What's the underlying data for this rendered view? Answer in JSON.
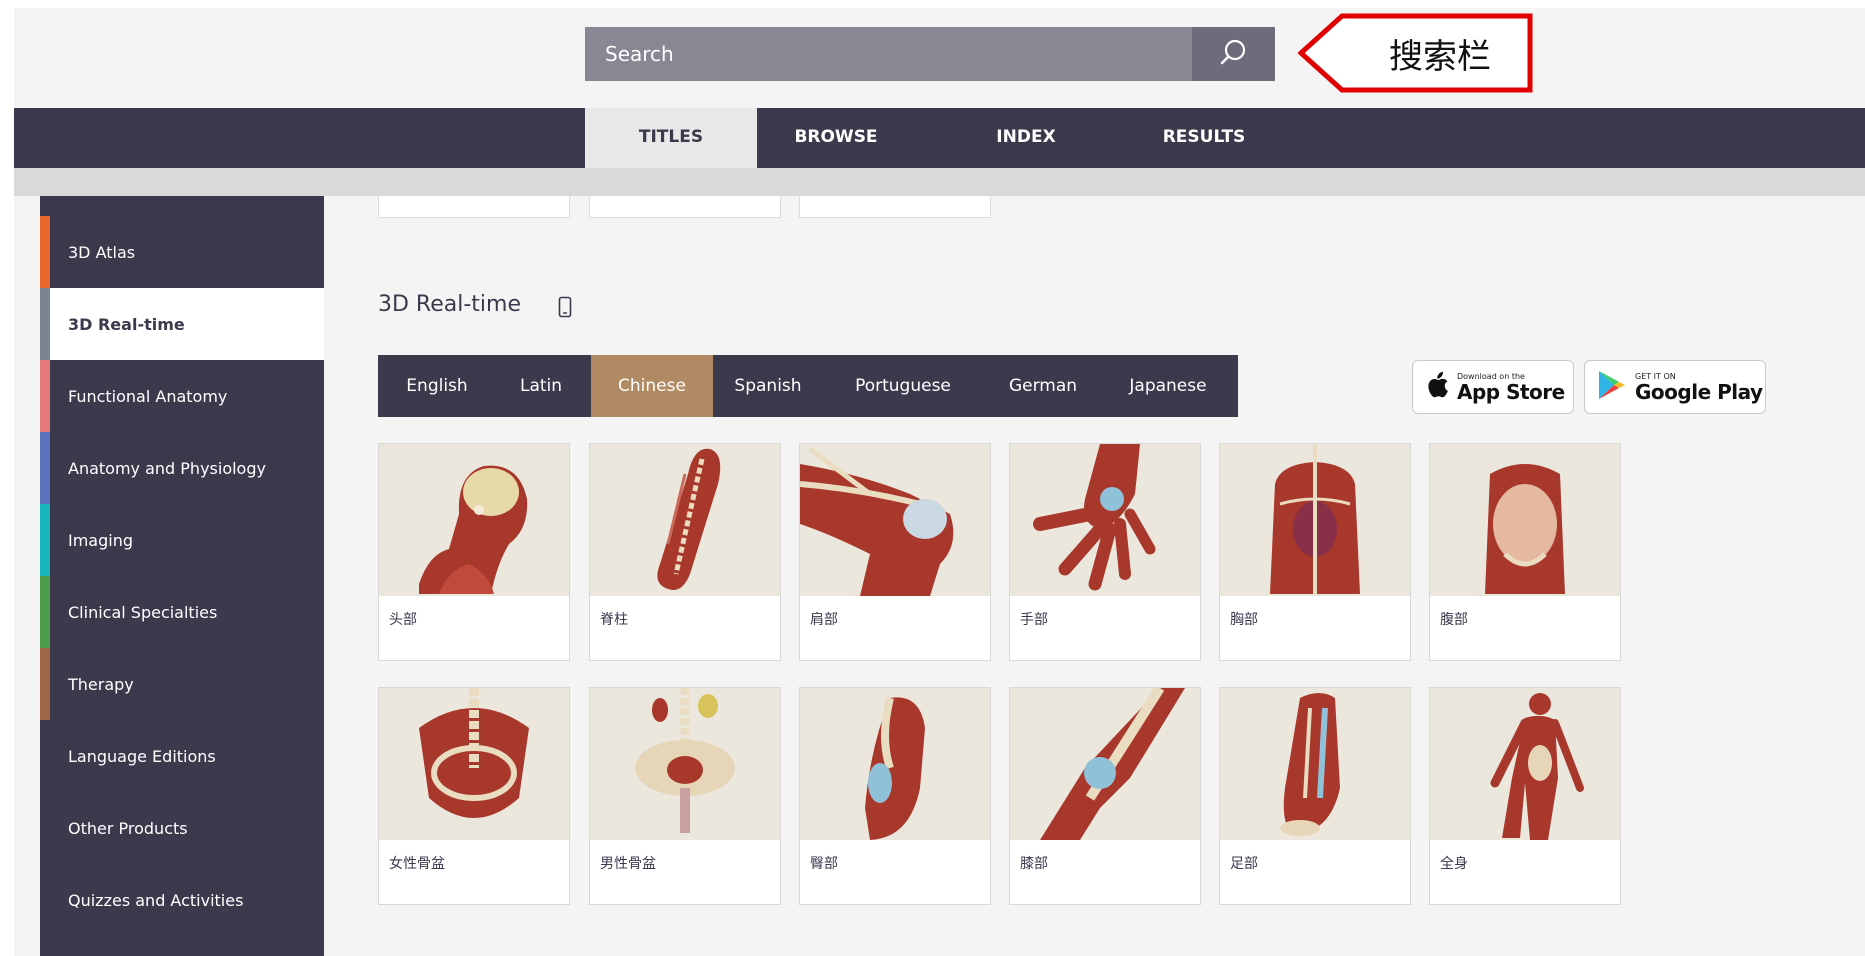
{
  "search": {
    "placeholder": "Search"
  },
  "annotation": {
    "label": "搜索栏",
    "color": "#e00000"
  },
  "top_nav": {
    "tabs": [
      {
        "label": "TITLES",
        "active": true
      },
      {
        "label": "BROWSE",
        "active": false
      },
      {
        "label": "INDEX",
        "active": false
      },
      {
        "label": "RESULTS",
        "active": false
      }
    ]
  },
  "sidebar": {
    "items": [
      {
        "label": "3D Atlas",
        "color": "#e9662c",
        "active": false
      },
      {
        "label": "3D Real-time",
        "color": "#7b8590",
        "active": true
      },
      {
        "label": "Functional Anatomy",
        "color": "#e57a7a",
        "active": false
      },
      {
        "label": "Anatomy and Physiology",
        "color": "#5e73c0",
        "active": false
      },
      {
        "label": "Imaging",
        "color": "#19b5bd",
        "active": false
      },
      {
        "label": "Clinical Specialties",
        "color": "#4c9e4a",
        "active": false
      },
      {
        "label": "Therapy",
        "color": "#9c6647",
        "active": false
      },
      {
        "label": "Language Editions",
        "color": "",
        "active": false
      },
      {
        "label": "Other Products",
        "color": "",
        "active": false
      },
      {
        "label": "Quizzes and Activities",
        "color": "",
        "active": false
      }
    ]
  },
  "section": {
    "title": "3D Real-time",
    "icon": "mobile-device-icon"
  },
  "languages": {
    "tabs": [
      {
        "label": "English",
        "active": false
      },
      {
        "label": "Latin",
        "active": false
      },
      {
        "label": "Chinese",
        "active": true
      },
      {
        "label": "Spanish",
        "active": false
      },
      {
        "label": "Portuguese",
        "active": false
      },
      {
        "label": "German",
        "active": false
      },
      {
        "label": "Japanese",
        "active": false
      }
    ]
  },
  "stores": {
    "apple": {
      "small": "Download on the",
      "big": "App Store",
      "icon": "apple-icon"
    },
    "google": {
      "small": "GET IT ON",
      "big": "Google Play",
      "icon": "google-play-icon"
    }
  },
  "cards": [
    {
      "label": "头部"
    },
    {
      "label": "脊柱"
    },
    {
      "label": "肩部"
    },
    {
      "label": "手部"
    },
    {
      "label": "胸部"
    },
    {
      "label": "腹部"
    },
    {
      "label": "女性骨盆"
    },
    {
      "label": "男性骨盆"
    },
    {
      "label": "臀部"
    },
    {
      "label": "膝部"
    },
    {
      "label": "足部"
    },
    {
      "label": "全身"
    }
  ]
}
